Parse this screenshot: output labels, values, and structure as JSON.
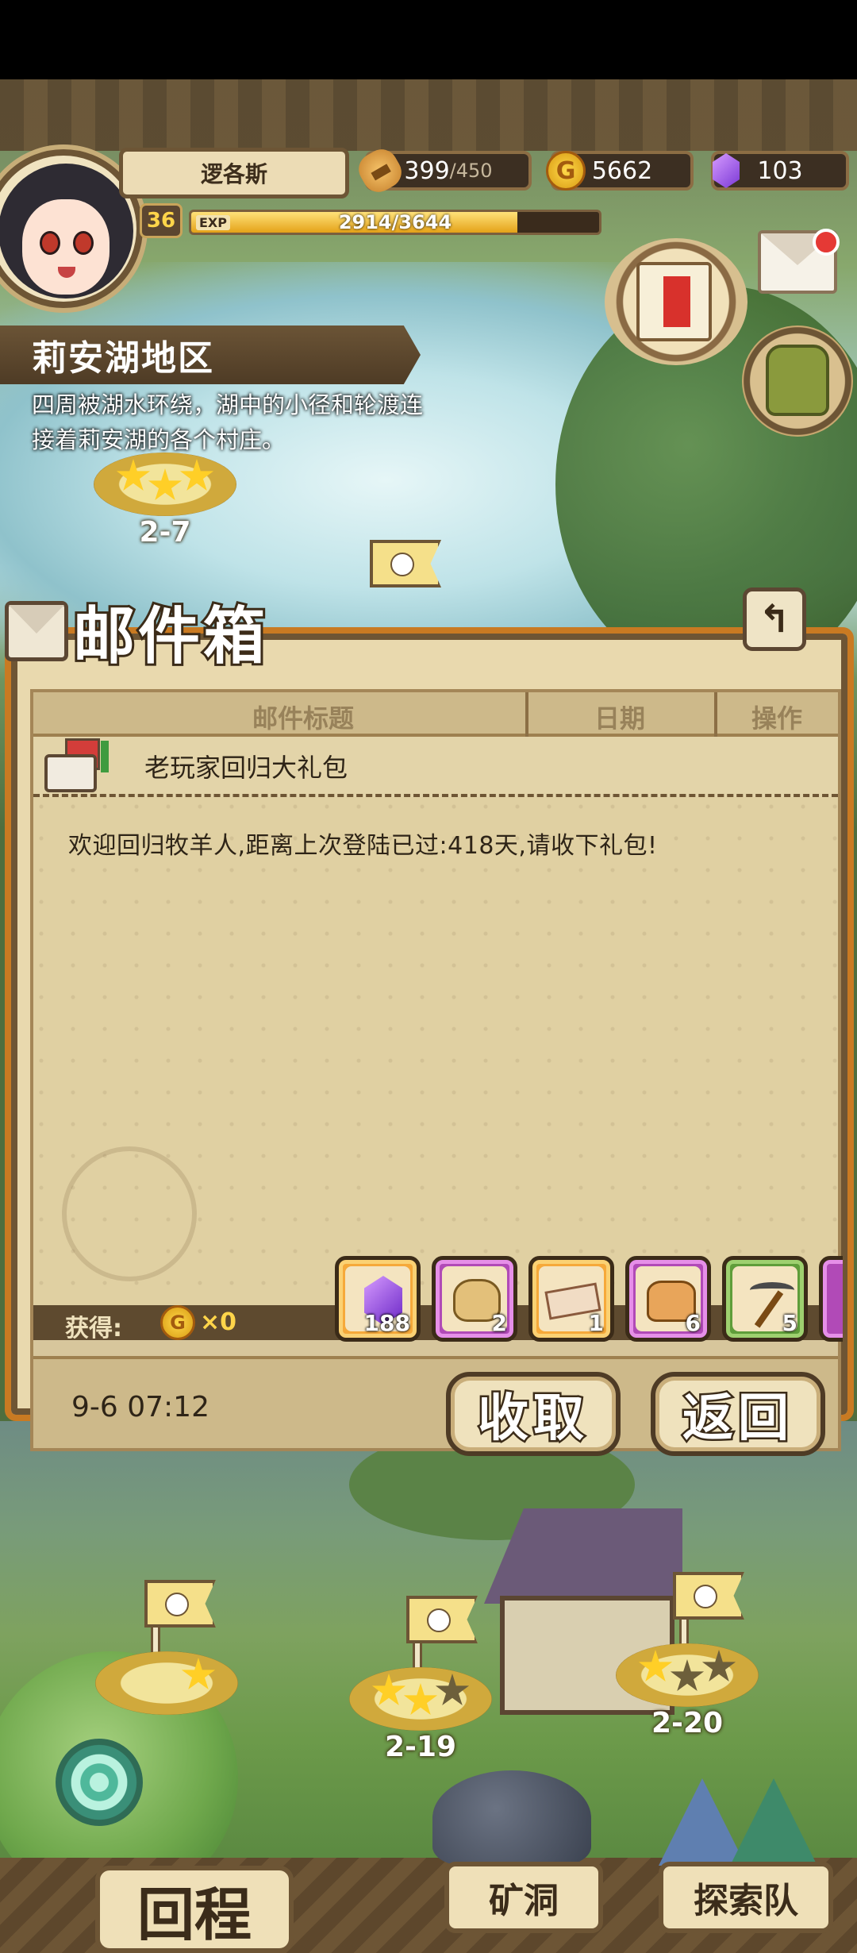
{
  "player": {
    "name": "逻各斯",
    "level": "36",
    "exp_label": "EXP",
    "exp_text": "2914/3644",
    "exp_ratio": 0.7997
  },
  "resources": {
    "bread_current": "399",
    "bread_max": "/450",
    "gold": "5662",
    "gems": "103",
    "gold_icon_glyph": "G"
  },
  "region": {
    "name": "莉安湖地区",
    "description": "四周被湖水环绕，湖中的小径和轮渡连接着莉安湖的各个村庄。"
  },
  "stages": [
    {
      "label": "2-7",
      "stars": 3
    },
    {
      "label": "2-19",
      "stars": 2
    },
    {
      "label": "2-20",
      "stars": 1
    }
  ],
  "mailbox": {
    "title": "邮件箱",
    "back_glyph": "↰",
    "columns": {
      "subject": "邮件标题",
      "date": "日期",
      "action": "操作"
    },
    "mail": {
      "subject": "老玩家回归大礼包",
      "content": "欢迎回归牧羊人,距离上次登陆已过:418天,请收下礼包!",
      "date": "9-6 07:12"
    },
    "reward_label": "获得:",
    "coin_amount": "×0",
    "coin_glyph": "G",
    "items": [
      {
        "name": "gem",
        "count": "188",
        "frame": "gold"
      },
      {
        "name": "gold-sack",
        "count": "2",
        "frame": "pink"
      },
      {
        "name": "ticket",
        "count": "1",
        "frame": "gold"
      },
      {
        "name": "bread-basket",
        "count": "6",
        "frame": "pink"
      },
      {
        "name": "pickaxe",
        "count": "5",
        "frame": "green"
      }
    ],
    "collect_label": "收取",
    "return_label": "返回"
  },
  "bottom_nav": {
    "return_label": "回程",
    "cave_label": "矿洞",
    "explore_label": "探索队"
  },
  "colors": {
    "panel_border": "#c97a22",
    "exp_fill": "#e5a218",
    "star_on": "#ffcf27",
    "notification": "#e53935"
  }
}
